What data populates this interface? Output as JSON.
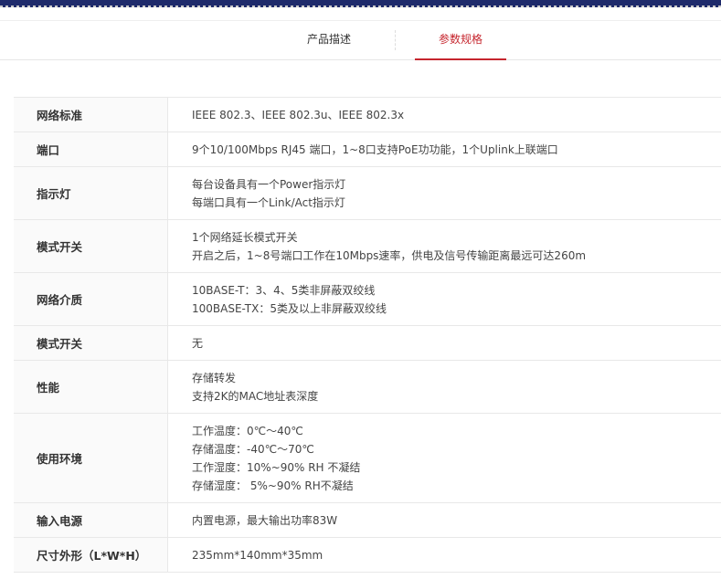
{
  "tabs": [
    {
      "label": "产品描述",
      "active": false
    },
    {
      "label": "参数规格",
      "active": true
    }
  ],
  "colors": {
    "accent": "#c6262e",
    "header_bar": "#1e2a6b"
  },
  "specs": [
    {
      "label": "网络标准",
      "lines": [
        "IEEE 802.3、IEEE 802.3u、IEEE 802.3x"
      ]
    },
    {
      "label": "端口",
      "lines": [
        "9个10/100Mbps RJ45 端口，1~8口支持PoE功功能，1个Uplink上联端口"
      ]
    },
    {
      "label": "指示灯",
      "lines": [
        "每台设备具有一个Power指示灯",
        "每端口具有一个Link/Act指示灯"
      ]
    },
    {
      "label": "模式开关",
      "lines": [
        "1个网络延长模式开关",
        "开启之后，1~8号端口工作在10Mbps速率，供电及信号传输距离最远可达260m"
      ]
    },
    {
      "label": "网络介质",
      "lines": [
        "10BASE-T：3、4、5类非屏蔽双绞线",
        "100BASE-TX：5类及以上非屏蔽双绞线"
      ]
    },
    {
      "label": "模式开关",
      "lines": [
        "无"
      ]
    },
    {
      "label": "性能",
      "lines": [
        "存储转发",
        "支持2K的MAC地址表深度"
      ]
    },
    {
      "label": "使用环境",
      "lines": [
        "工作温度：0℃～40℃",
        "存储温度：-40℃～70℃",
        "工作湿度：10%~90% RH 不凝结",
        "存储湿度： 5%~90% RH不凝结"
      ]
    },
    {
      "label": "输入电源",
      "lines": [
        "内置电源，最大输出功率83W"
      ]
    },
    {
      "label": "尺寸外形（L*W*H）",
      "lines": [
        "235mm*140mm*35mm"
      ]
    }
  ]
}
